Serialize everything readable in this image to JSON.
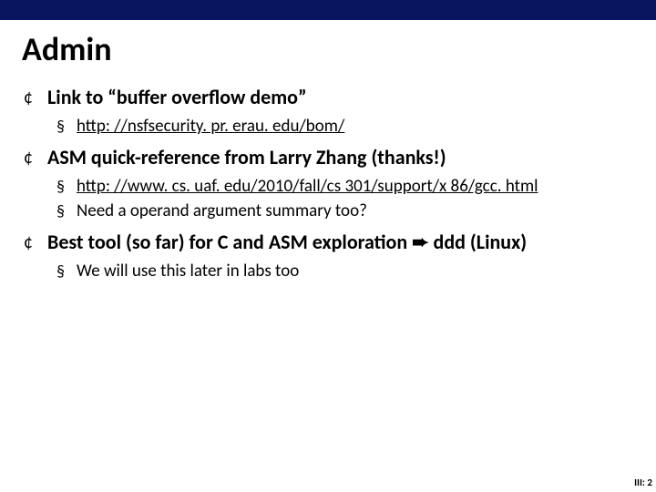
{
  "title": "Admin",
  "items": [
    {
      "text": "Link to “buffer overflow demo”",
      "sub": [
        {
          "link": "http: //nsfsecurity. pr. erau. edu/bom/"
        }
      ]
    },
    {
      "text": "ASM quick-reference from Larry Zhang (thanks!)",
      "sub": [
        {
          "link": "http: //www. cs. uaf. edu/2010/fall/cs 301/support/x 86/gcc. html"
        },
        {
          "text": "Need a operand argument summary too?"
        }
      ]
    },
    {
      "text_pre": "Best tool (so far) for C and ASM exploration ",
      "arrow": "➨",
      "text_post": " ddd (Linux)",
      "sub": [
        {
          "text": "We will use this later in labs too"
        }
      ]
    }
  ],
  "footer": "III: 2"
}
